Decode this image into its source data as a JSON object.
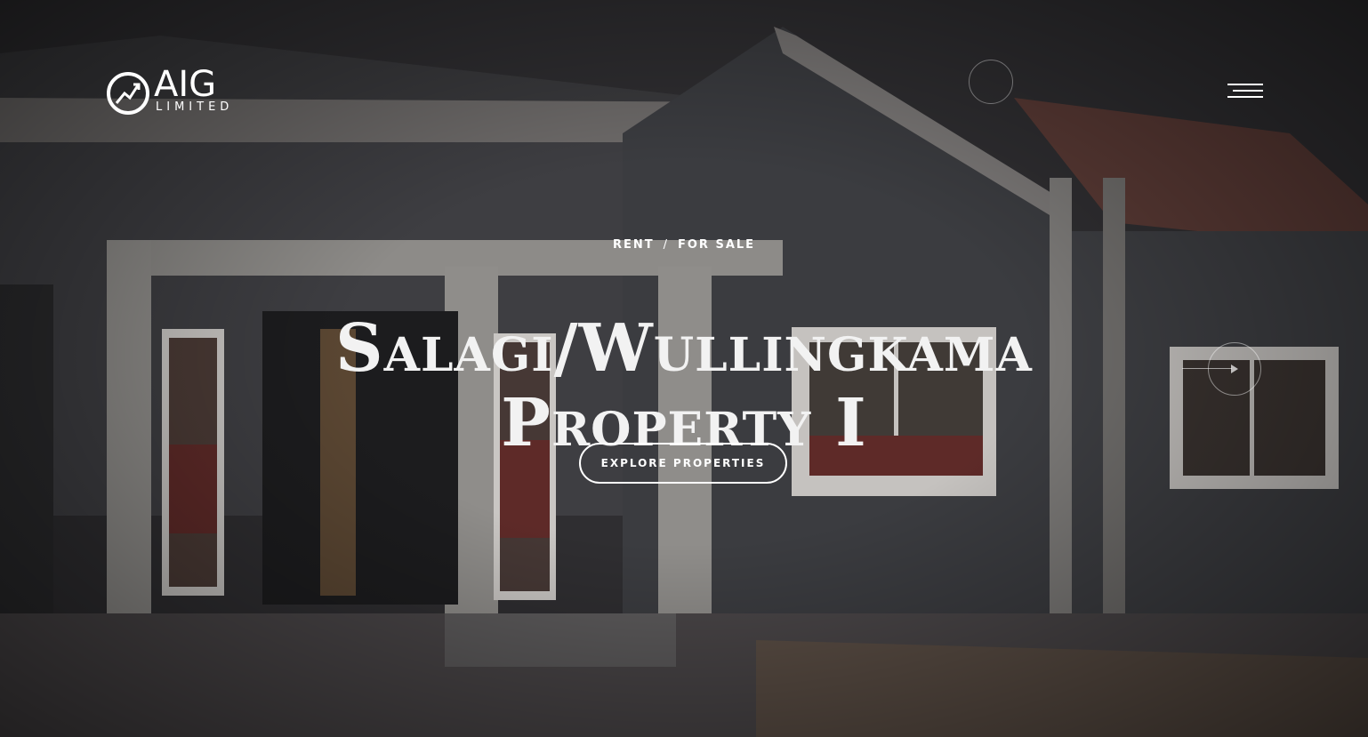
{
  "header": {
    "logo": {
      "name": "AIG",
      "subtitle": "LIMITED"
    },
    "menu_icon": "hamburger-menu-icon"
  },
  "hero": {
    "categories": [
      "RENT",
      "FOR SALE"
    ],
    "category_separator": "/",
    "title_line1": "Salagi/Wullingkama",
    "title_line2": "Property I",
    "cta_label": "EXPLORE PROPERTIES",
    "next_icon": "arrow-right-icon"
  },
  "colors": {
    "text": "#ffffff",
    "overlay": "#2b2a2c"
  }
}
